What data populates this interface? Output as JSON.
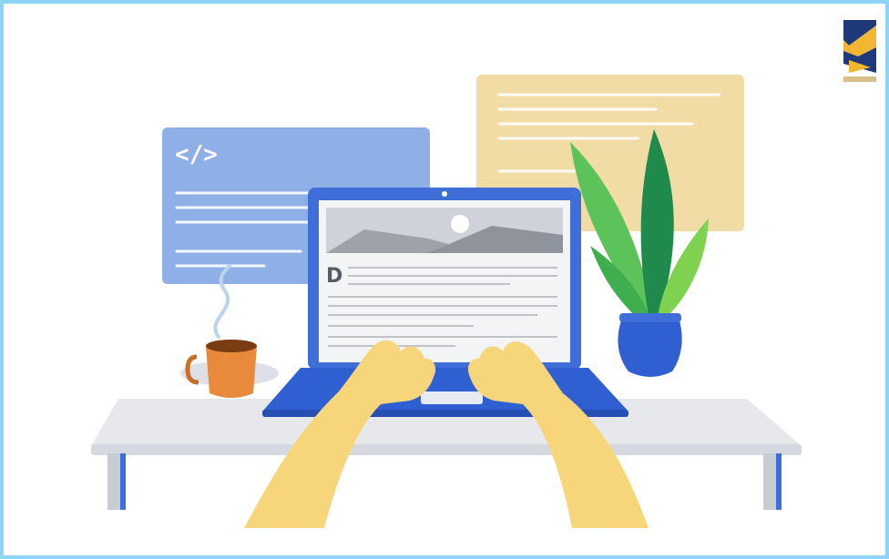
{
  "illustration": {
    "code_symbol": "</>",
    "document_letter": "D"
  },
  "colors": {
    "border": "#8fd3f6",
    "code_window": "#8fb0e6",
    "notes_window": "#f2dca6",
    "laptop_blue": "#3f6ed8",
    "desk": "#e6e8ec",
    "hands": "#f7d67b",
    "mug": "#e8893c",
    "pot": "#2f5fd0",
    "leaf_light": "#5cc35a",
    "leaf_dark": "#1f8a4c"
  }
}
